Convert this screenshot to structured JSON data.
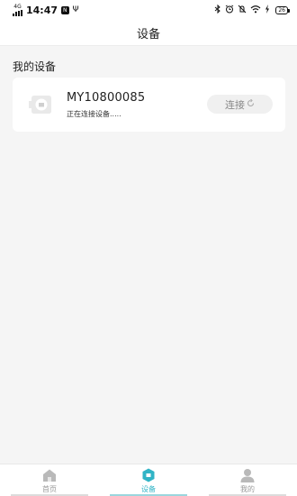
{
  "status_bar": {
    "network": "4G",
    "time": "14:47",
    "badge": "N",
    "usb": "Ψ",
    "icons": [
      "bluetooth-icon",
      "alarm-icon",
      "mute-icon",
      "wifi-icon",
      "charging-icon"
    ],
    "battery": "26"
  },
  "header": {
    "title": "设备"
  },
  "main": {
    "section_title": "我的设备",
    "device": {
      "name": "MY10800085",
      "status": "正在连接设备.....",
      "connect_label": "连接"
    }
  },
  "tabs": [
    {
      "label": "首页",
      "icon": "home-icon",
      "active": false
    },
    {
      "label": "设备",
      "icon": "device-icon",
      "active": true
    },
    {
      "label": "我的",
      "icon": "user-icon",
      "active": false
    }
  ],
  "colors": {
    "accent": "#31b4c6",
    "background": "#f5f5f5",
    "card": "#ffffff",
    "inactive": "#999999"
  }
}
